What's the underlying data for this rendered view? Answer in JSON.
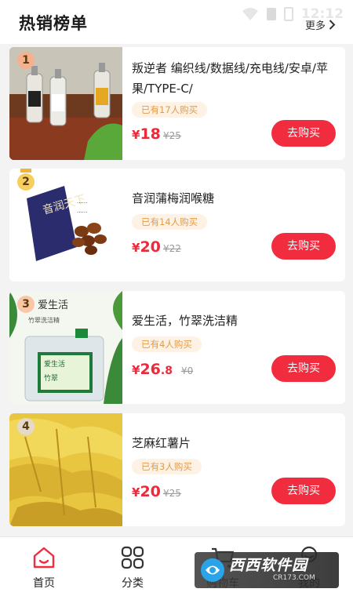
{
  "header": {
    "title": "热销榜单",
    "more_label": "更多",
    "status_time": "12:12"
  },
  "products": [
    {
      "rank": "1",
      "name": "叛逆者 编织线/数据线/充电线/安卓/苹果/TYPE-C/",
      "sold": "已有17人购买",
      "price_yen": "¥",
      "price_int": "18",
      "price_dec": "",
      "old_price": "¥25",
      "buy_label": "去购买"
    },
    {
      "rank": "2",
      "name": "音润蒲梅润喉糖",
      "sold": "已有14人购买",
      "price_yen": "¥",
      "price_int": "20",
      "price_dec": "",
      "old_price": "¥22",
      "buy_label": "去购买"
    },
    {
      "rank": "3",
      "name": "爱生活，竹翠洗洁精",
      "sold": "已有4人购买",
      "price_yen": "¥",
      "price_int": "26",
      "price_dec": ".8",
      "old_price": "¥0",
      "buy_label": "去购买"
    },
    {
      "rank": "4",
      "name": "芝麻红薯片",
      "sold": "已有3人购买",
      "price_yen": "¥",
      "price_int": "20",
      "price_dec": "",
      "old_price": "¥25",
      "buy_label": "去购买"
    }
  ],
  "product_images": {
    "p2_pack_text": "音润天下",
    "p3_label_top": "爱生活",
    "p3_label_line": "竹翠洗洁精"
  },
  "tabbar": {
    "items": [
      {
        "label": "首页",
        "icon": "home-icon"
      },
      {
        "label": "分类",
        "icon": "grid-icon"
      },
      {
        "label": "购物车",
        "icon": "cart-icon"
      },
      {
        "label": "我的",
        "icon": "user-icon"
      }
    ]
  },
  "watermark": {
    "text": "西西软件园",
    "sub": "CR173.COM"
  },
  "colors": {
    "accent": "#f12c3f",
    "price": "#ea2b3b",
    "badge_bg": "#fdf2e4",
    "badge_text": "#e39b4c"
  }
}
